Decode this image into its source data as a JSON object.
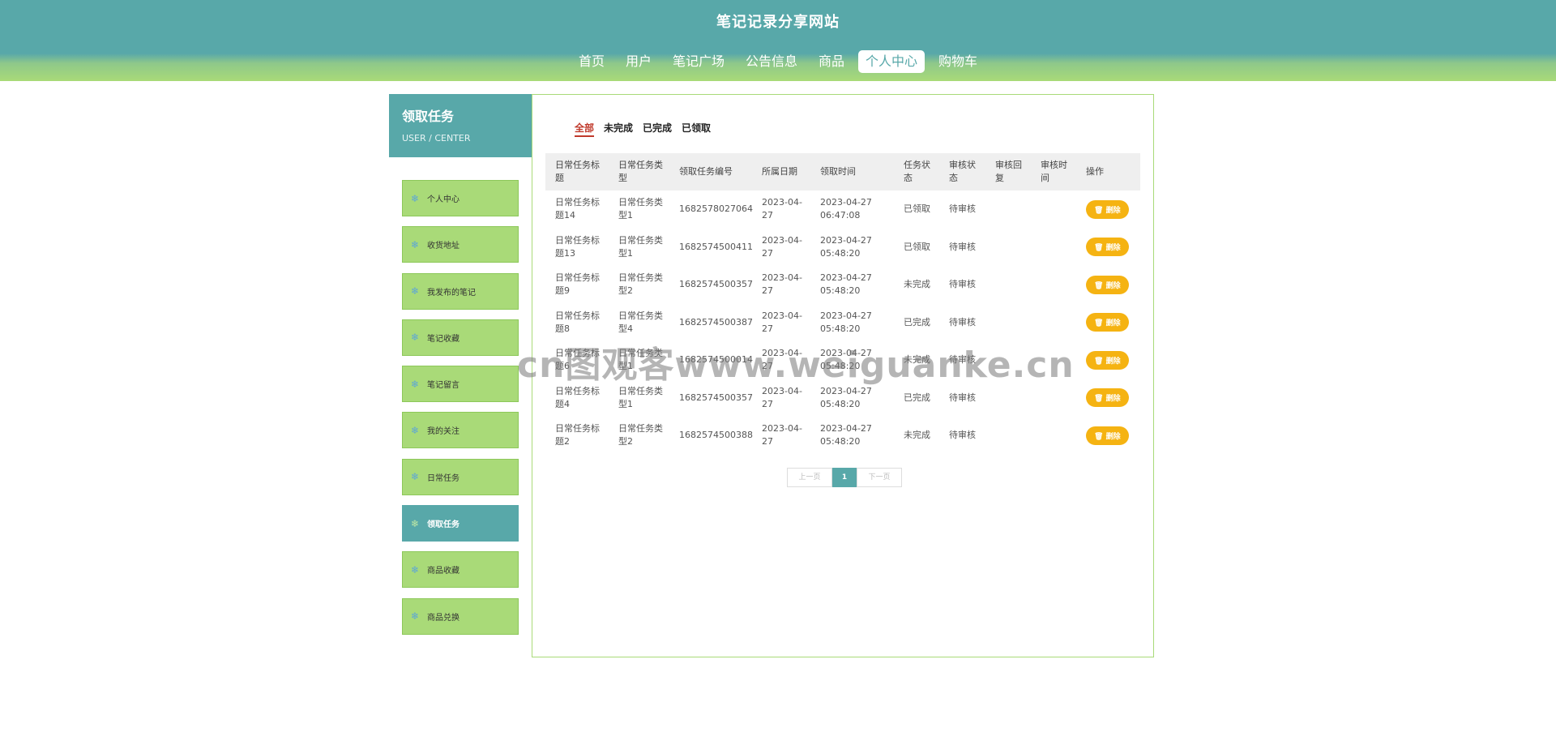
{
  "site": {
    "title": "笔记记录分享网站"
  },
  "nav": [
    {
      "label": "首页",
      "active": false
    },
    {
      "label": "用户",
      "active": false
    },
    {
      "label": "笔记广场",
      "active": false
    },
    {
      "label": "公告信息",
      "active": false
    },
    {
      "label": "商品",
      "active": false
    },
    {
      "label": "个人中心",
      "active": true
    },
    {
      "label": "购物车",
      "active": false
    }
  ],
  "sidebar": {
    "title": "领取任务",
    "subtitle": "USER / CENTER",
    "items": [
      {
        "label": "个人中心",
        "active": false
      },
      {
        "label": "收货地址",
        "active": false
      },
      {
        "label": "我发布的笔记",
        "active": false
      },
      {
        "label": "笔记收藏",
        "active": false
      },
      {
        "label": "笔记留言",
        "active": false
      },
      {
        "label": "我的关注",
        "active": false
      },
      {
        "label": "日常任务",
        "active": false
      },
      {
        "label": "领取任务",
        "active": true
      },
      {
        "label": "商品收藏",
        "active": false
      },
      {
        "label": "商品兑换",
        "active": false
      }
    ]
  },
  "filters": [
    {
      "label": "全部",
      "active": true
    },
    {
      "label": "未完成",
      "active": false
    },
    {
      "label": "已完成",
      "active": false
    },
    {
      "label": "已领取",
      "active": false
    }
  ],
  "table": {
    "headers": [
      "日常任务标题",
      "日常任务类型",
      "领取任务编号",
      "所属日期",
      "领取时间",
      "任务状态",
      "审核状态",
      "审核回复",
      "审核时间",
      "操作"
    ],
    "rows": [
      {
        "title": "日常任务标题14",
        "type": "日常任务类型1",
        "code": "1682578027064",
        "date": "2023-04-27",
        "time": "2023-04-27 06:47:08",
        "status": "已领取",
        "audit": "待审核",
        "reply": "",
        "audit_time": "",
        "action": "删除"
      },
      {
        "title": "日常任务标题13",
        "type": "日常任务类型1",
        "code": "1682574500411",
        "date": "2023-04-27",
        "time": "2023-04-27 05:48:20",
        "status": "已领取",
        "audit": "待审核",
        "reply": "",
        "audit_time": "",
        "action": "删除"
      },
      {
        "title": "日常任务标题9",
        "type": "日常任务类型2",
        "code": "1682574500357",
        "date": "2023-04-27",
        "time": "2023-04-27 05:48:20",
        "status": "未完成",
        "audit": "待审核",
        "reply": "",
        "audit_time": "",
        "action": "删除"
      },
      {
        "title": "日常任务标题8",
        "type": "日常任务类型4",
        "code": "1682574500387",
        "date": "2023-04-27",
        "time": "2023-04-27 05:48:20",
        "status": "已完成",
        "audit": "待审核",
        "reply": "",
        "audit_time": "",
        "action": "删除"
      },
      {
        "title": "日常任务标题6",
        "type": "日常任务类型1",
        "code": "1682574500014",
        "date": "2023-04-27",
        "time": "2023-04-27 05:48:20",
        "status": "未完成",
        "audit": "待审核",
        "reply": "",
        "audit_time": "",
        "action": "删除"
      },
      {
        "title": "日常任务标题4",
        "type": "日常任务类型1",
        "code": "1682574500357",
        "date": "2023-04-27",
        "time": "2023-04-27 05:48:20",
        "status": "已完成",
        "audit": "待审核",
        "reply": "",
        "audit_time": "",
        "action": "删除"
      },
      {
        "title": "日常任务标题2",
        "type": "日常任务类型2",
        "code": "1682574500388",
        "date": "2023-04-27",
        "time": "2023-04-27 05:48:20",
        "status": "未完成",
        "audit": "待审核",
        "reply": "",
        "audit_time": "",
        "action": "删除"
      }
    ]
  },
  "pager": {
    "prev": "上一页",
    "current": "1",
    "next": "下一页"
  },
  "watermark": "cn图观客www.weiguanke.cn",
  "colors": {
    "teal": "#58a8a9",
    "green": "#a9da78",
    "delete": "#f5b312",
    "active_filter": "#c0392b"
  },
  "icons": {
    "sidebar_item": "snowflake-icon",
    "delete_button": "trash-icon"
  }
}
